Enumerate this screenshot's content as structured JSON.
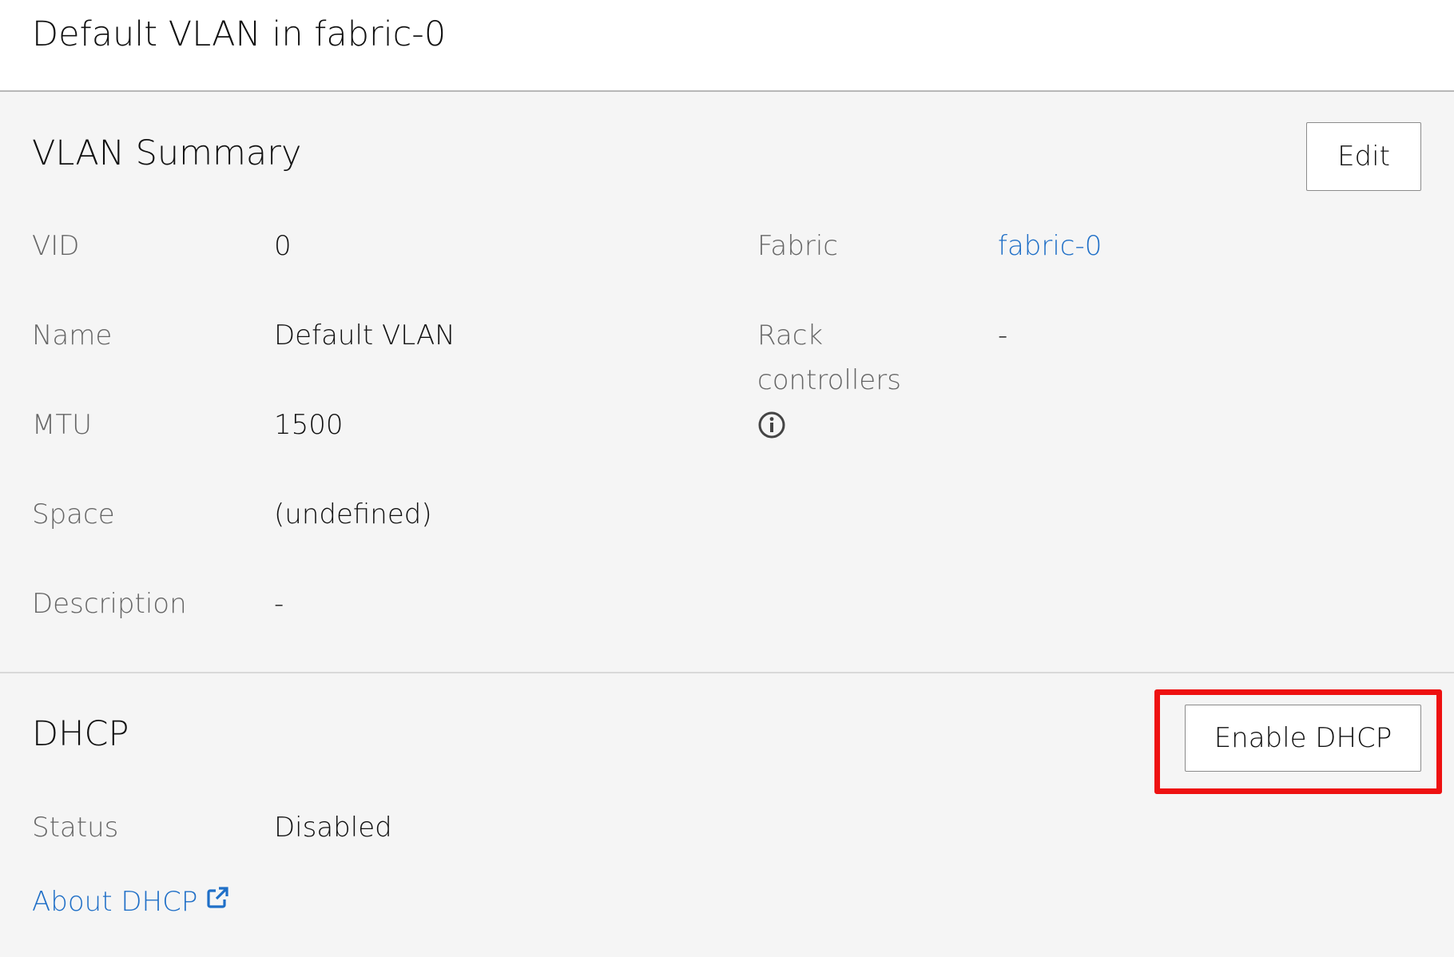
{
  "header": {
    "title": "Default VLAN in fabric-0"
  },
  "vlan_summary": {
    "title": "VLAN Summary",
    "edit_label": "Edit",
    "left_fields": [
      {
        "label": "VID",
        "value": "0"
      },
      {
        "label": "Name",
        "value": "Default VLAN"
      },
      {
        "label": "MTU",
        "value": "1500"
      },
      {
        "label": "Space",
        "value": "(undefined)"
      },
      {
        "label": "Description",
        "value": "-"
      }
    ],
    "fabric": {
      "label": "Fabric",
      "value": "fabric-0"
    },
    "rack_controllers": {
      "label_line1": "Rack",
      "label_line2": "controllers",
      "value": "-",
      "info_icon": "info-icon"
    }
  },
  "dhcp": {
    "title": "DHCP",
    "enable_label": "Enable DHCP",
    "status_label": "Status",
    "status_value": "Disabled",
    "about_link": "About DHCP",
    "about_icon": "external-link-icon"
  },
  "colors": {
    "link": "#1f6fc7",
    "highlight": "#ee1111",
    "label": "#666666",
    "background": "#f5f5f5"
  }
}
